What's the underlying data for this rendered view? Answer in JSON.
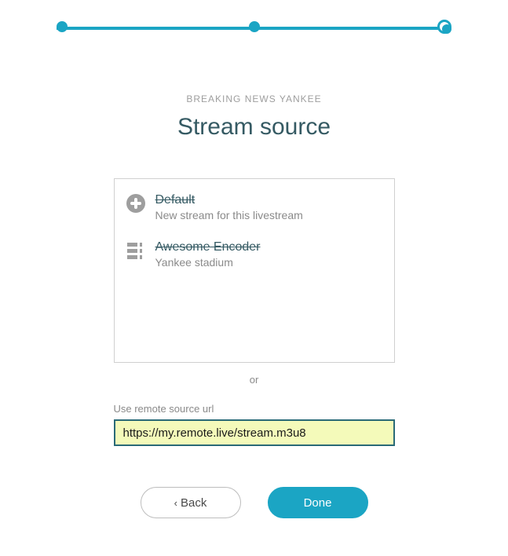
{
  "stepper": {
    "steps": 3,
    "current": 3
  },
  "header": {
    "subtitle": "BREAKING NEWS YANKEE",
    "title": "Stream source"
  },
  "sources": [
    {
      "icon": "plus-circle-icon",
      "name": "Default",
      "desc": "New stream for this livestream",
      "disabled": true
    },
    {
      "icon": "encoder-icon",
      "name": "Awesome Encoder",
      "desc": "Yankee stadium",
      "disabled": true
    }
  ],
  "divider": "or",
  "url_section": {
    "label": "Use remote source url",
    "value": "https://my.remote.live/stream.m3u8"
  },
  "buttons": {
    "back": "Back",
    "done": "Done"
  },
  "colors": {
    "accent": "#1ba5c4",
    "heading": "#355a63",
    "highlight_bg": "#f4faba"
  }
}
